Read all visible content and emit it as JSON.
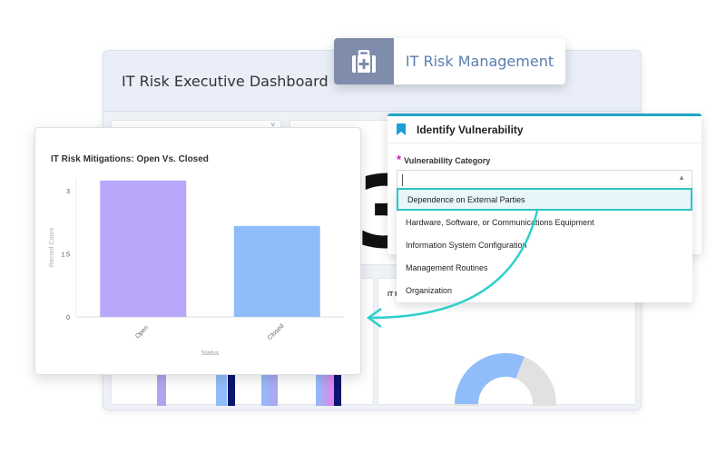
{
  "dashboard": {
    "title": "IT Risk Executive Dashboard",
    "big_number": "3",
    "panel_label": "IT R"
  },
  "badge": {
    "icon": "medical-kit-icon",
    "label": "IT Risk Management",
    "icon_bg": "#7f8cab"
  },
  "chart_data": {
    "type": "bar",
    "title": "IT Risk Mitigations: Open Vs. Closed",
    "categories": [
      "Open",
      "Closed"
    ],
    "values": [
      3.24,
      2.16
    ],
    "colors": [
      "#b8a7fb",
      "#90bdfa"
    ],
    "xlabel": "Status",
    "ylabel": "Record Count",
    "yticks": [
      "0",
      "1.5",
      "3"
    ],
    "ylim": [
      0,
      3.3
    ]
  },
  "form": {
    "title": "Identify Vulnerability",
    "field_label": "Vulnerability Category",
    "input_value": "",
    "options": [
      "Dependence on External Parties",
      "Hardware, Software, or Communications Equipment",
      "Information System Configuration",
      "Management Routines",
      "Organization"
    ],
    "selected": 0,
    "accent": "#1fa6c9"
  }
}
